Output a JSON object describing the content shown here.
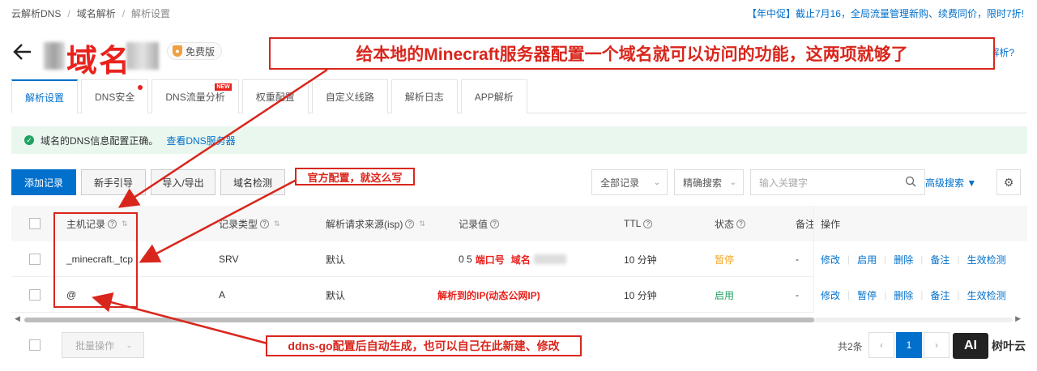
{
  "breadcrumb": [
    "云解析DNS",
    "域名解析",
    "解析设置"
  ],
  "promo": "【年中促】截止7月16，全局流量管理新购、续费同价，限时7折!",
  "title": "域名",
  "free_badge": "免费版",
  "help_link": "设置解析?",
  "tabs": [
    {
      "label": "解析设置",
      "active": true
    },
    {
      "label": "DNS安全",
      "dot": true
    },
    {
      "label": "DNS流量分析",
      "badge": "NEW"
    },
    {
      "label": "权重配置"
    },
    {
      "label": "自定义线路"
    },
    {
      "label": "解析日志"
    },
    {
      "label": "APP解析"
    }
  ],
  "alert": {
    "text": "域名的DNS信息配置正确。",
    "link": "查看DNS服务器"
  },
  "toolbar": {
    "add": "添加记录",
    "guide": "新手引导",
    "import_export": "导入/导出",
    "check": "域名检测",
    "all_records": "全部记录",
    "exact_search": "精确搜索",
    "search_placeholder": "输入关键字",
    "advanced": "高级搜索"
  },
  "table": {
    "headers": [
      "主机记录",
      "记录类型",
      "解析请求来源(isp)",
      "记录值",
      "TTL",
      "状态",
      "备注",
      "操作"
    ],
    "rows": [
      {
        "host": "_minecraft._tcp",
        "type": "SRV",
        "isp": "默认",
        "value_prefix": "0 5",
        "value_port": "端口号",
        "value_domain": "域名",
        "ttl": "10 分钟",
        "status": "暂停",
        "note": "-",
        "ops": [
          "修改",
          "启用",
          "删除",
          "备注",
          "生效检测"
        ]
      },
      {
        "host": "@",
        "type": "A",
        "isp": "默认",
        "value_note": "解析到的IP(动态公网IP)",
        "ttl": "10 分钟",
        "status": "启用",
        "note": "-",
        "ops": [
          "修改",
          "暂停",
          "删除",
          "备注",
          "生效检测"
        ]
      }
    ]
  },
  "footer": {
    "batch": "批量操作",
    "total": "共2条",
    "page": "1"
  },
  "annotations": {
    "top": "给本地的Minecraft服务器配置一个域名就可以访问的功能，这两项就够了",
    "official": "官方配置，就这么写",
    "ddns": "ddns-go配置后自动生成，也可以自己在此新建、修改"
  },
  "watermark": {
    "logo": "AI",
    "text": "树叶云"
  },
  "colors": {
    "accent": "#0070cc",
    "annotation": "#d9261c",
    "success": "#1fa361",
    "warning": "#f5a623"
  }
}
